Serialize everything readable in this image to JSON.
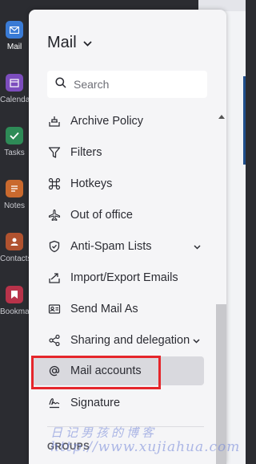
{
  "rail": {
    "items": [
      {
        "label": "Mail",
        "icon": "mail-icon",
        "color": "#3a7bd5"
      },
      {
        "label": "Calendar",
        "icon": "calendar-icon",
        "color": "#7c4dbd"
      },
      {
        "label": "Tasks",
        "icon": "tasks-icon",
        "color": "#2e8b57"
      },
      {
        "label": "Notes",
        "icon": "notes-icon",
        "color": "#c9692e"
      },
      {
        "label": "Contacts",
        "icon": "contacts-icon",
        "color": "#b0522f"
      },
      {
        "label": "Bookmarks",
        "icon": "bookmarks-icon",
        "color": "#b8334a"
      }
    ]
  },
  "panel": {
    "title": "Mail",
    "search_placeholder": "Search",
    "items": [
      {
        "label": "Archive Policy",
        "icon": "archive-icon"
      },
      {
        "label": "Filters",
        "icon": "filter-icon"
      },
      {
        "label": "Hotkeys",
        "icon": "command-key-icon"
      },
      {
        "label": "Out of office",
        "icon": "airplane-icon"
      },
      {
        "label": "Anti-Spam Lists",
        "icon": "shield-icon",
        "has_submenu": true
      },
      {
        "label": "Import/Export Emails",
        "icon": "import-export-icon"
      },
      {
        "label": "Send Mail As",
        "icon": "id-card-icon"
      },
      {
        "label": "Sharing and delegation",
        "icon": "share-icon",
        "has_submenu": true
      },
      {
        "label": "Mail accounts",
        "icon": "at-icon",
        "active": true
      },
      {
        "label": "Signature",
        "icon": "signature-icon"
      }
    ],
    "section_header": "GROUPS"
  },
  "colors": {
    "highlight": "#e5262b",
    "active_bg": "#d9d9de",
    "panel_bg": "#f5f5f7",
    "rail_bg": "#2b2c31"
  },
  "watermark": {
    "line1": "日记男孩的博客",
    "line2": "http://www.xujiahua.com"
  }
}
